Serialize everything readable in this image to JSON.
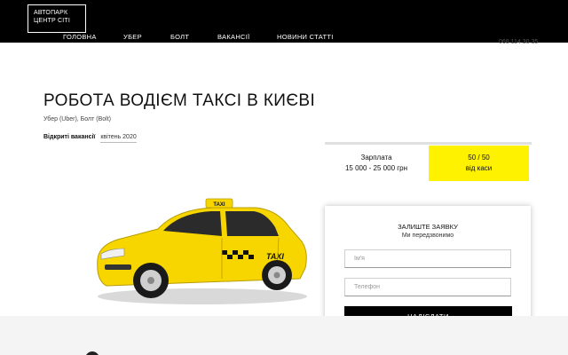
{
  "header": {
    "logo_line1": "АВТОПАРК",
    "logo_line2": "ЦЕНТР СІТІ",
    "nav": [
      {
        "label": "ГОЛОВНА"
      },
      {
        "label": "УБЕР"
      },
      {
        "label": "БОЛТ"
      },
      {
        "label": "ВАКАНСІЇ"
      },
      {
        "label": "НОВИНИ СТАТТІ"
      }
    ],
    "phone": "068 114 30 35"
  },
  "hero": {
    "title": "РОБОТА ВОДІЄМ ТАКСІ В КИЄВІ",
    "subtitle": "Убер (Uber), Болт (Bolt)",
    "vacancies_label": "Відкриті вакансії",
    "vacancies_date": "квітень 2020"
  },
  "salary": {
    "label": "Зарплата",
    "range": "15 000 - 25 000 грн"
  },
  "share": {
    "ratio": "50 / 50",
    "label": "від каси"
  },
  "form": {
    "title": "ЗАЛИШТЕ ЗАЯВКУ",
    "subtitle": "Ми передзвонимо",
    "name_placeholder": "Ім'я",
    "phone_placeholder": "Телефон",
    "submit_label": "НАДІСЛАТИ"
  },
  "car": {
    "roof_sign": "TAXI",
    "door_text": "TAXI"
  },
  "colors": {
    "accent": "#fff200",
    "header_bg": "#000000",
    "taxi_yellow": "#f7d600"
  }
}
